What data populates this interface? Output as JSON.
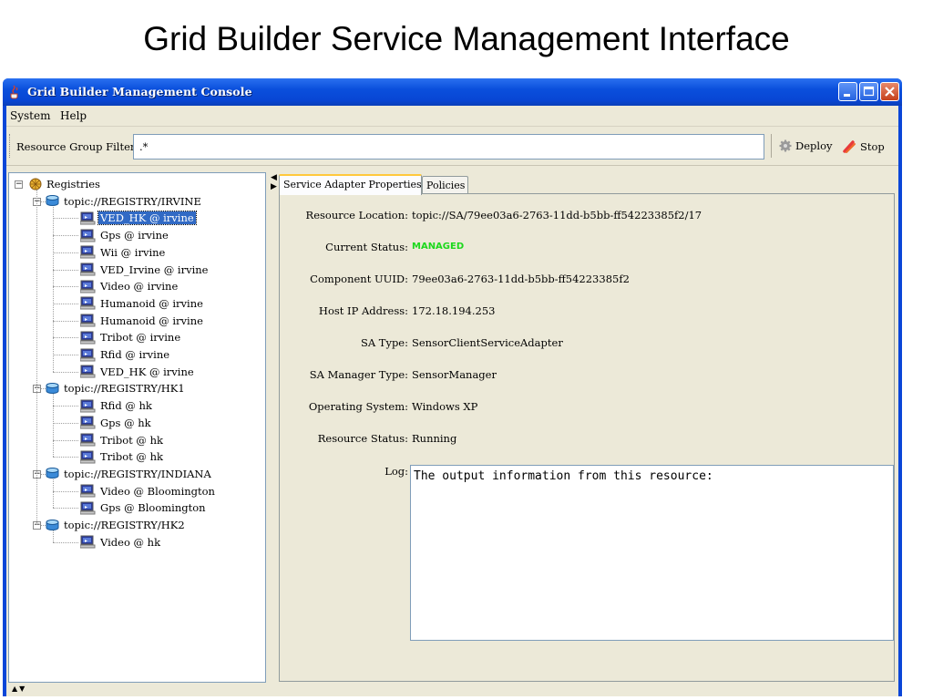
{
  "slide": {
    "title": "Grid Builder Service Management Interface"
  },
  "window": {
    "title": "Grid Builder Management Console",
    "menu": [
      "System",
      "Help"
    ]
  },
  "toolbar": {
    "filter_label": "Resource Group Filter:",
    "filter_value": ".*",
    "deploy_label": "Deploy",
    "stop_label": "Stop"
  },
  "tree": {
    "root": "Registries",
    "registries": [
      {
        "name": "topic://REGISTRY/IRVINE",
        "items": [
          "VED_HK @ irvine",
          "Gps @ irvine",
          "Wii @ irvine",
          "VED_Irvine @ irvine",
          "Video @ irvine",
          "Humanoid @ irvine",
          "Humanoid @ irvine",
          "Tribot @ irvine",
          "Rfid @ irvine",
          "VED_HK @ irvine"
        ]
      },
      {
        "name": "topic://REGISTRY/HK1",
        "items": [
          "Rfid @ hk",
          "Gps @ hk",
          "Tribot @ hk",
          "Tribot @ hk"
        ]
      },
      {
        "name": "topic://REGISTRY/INDIANA",
        "items": [
          "Video @ Bloomington",
          "Gps @ Bloomington"
        ]
      },
      {
        "name": "topic://REGISTRY/HK2",
        "items": [
          "Video @ hk"
        ]
      }
    ],
    "selected": "VED_HK @ irvine"
  },
  "tabs": [
    "Service Adapter Properties",
    "Policies"
  ],
  "properties": [
    {
      "label": "Resource Location:",
      "value": "topic://SA/79ee03a6-2763-11dd-b5bb-ff54223385f2/17"
    },
    {
      "label": "Current Status:",
      "value": "MANAGED"
    },
    {
      "label": "Component UUID:",
      "value": "79ee03a6-2763-11dd-b5bb-ff54223385f2"
    },
    {
      "label": "Host IP Address:",
      "value": "172.18.194.253"
    },
    {
      "label": "SA Type:",
      "value": "SensorClientServiceAdapter"
    },
    {
      "label": "SA Manager Type:",
      "value": "SensorManager"
    },
    {
      "label": "Operating System:",
      "value": "Windows XP"
    },
    {
      "label": "Resource Status:",
      "value": "Running"
    }
  ],
  "log": {
    "label": "Log:",
    "text": "The output information from this resource:"
  },
  "colors": {
    "titlebar": "#0a4fdc",
    "managed": "#1cd81c",
    "selection": "#316ac5",
    "tab_highlight": "#ffc83c"
  },
  "icons": {
    "app": "java-cup-icon",
    "root": "registry-root-icon",
    "registry": "database-icon",
    "resource": "computer-icon",
    "deploy": "gear-icon",
    "stop": "stop-icon"
  }
}
